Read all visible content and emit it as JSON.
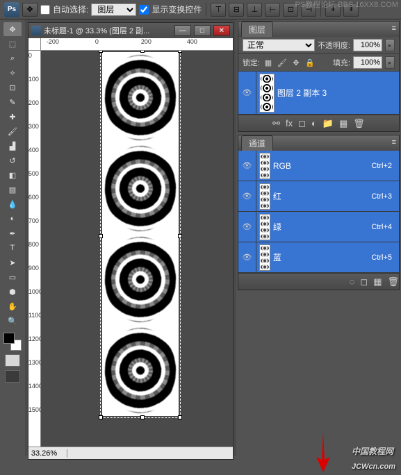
{
  "options": {
    "auto_select_label": "自动选择:",
    "auto_select_target": "图层",
    "show_transform_label": "显示变换控件"
  },
  "doc": {
    "title": "未标题-1 @ 33.3% (图层 2 副...",
    "zoom": "33.26%",
    "ruler_h": [
      "-200",
      "0",
      "200",
      "400"
    ],
    "ruler_v": [
      "0",
      "100",
      "200",
      "300",
      "400",
      "500",
      "600",
      "700",
      "800",
      "900",
      "1000",
      "1100",
      "1200",
      "1300",
      "1400",
      "1500"
    ]
  },
  "panels": {
    "layers": {
      "tab": "图层",
      "blend_mode": "正常",
      "opacity_label": "不透明度:",
      "opacity_value": "100%",
      "lock_label": "锁定:",
      "fill_label": "填充:",
      "fill_value": "100%",
      "layer_name": "图层 2 副本 3"
    },
    "channels": {
      "tab": "通道",
      "items": [
        {
          "name": "RGB",
          "shortcut": "Ctrl+2"
        },
        {
          "name": "红",
          "shortcut": "Ctrl+3"
        },
        {
          "name": "绿",
          "shortcut": "Ctrl+4"
        },
        {
          "name": "蓝",
          "shortcut": "Ctrl+5"
        }
      ]
    }
  },
  "watermark": {
    "top": "PS教程论坛\nBBS.16XX8.COM",
    "center": "中国教程网",
    "bottom": "JCWcn.com"
  }
}
